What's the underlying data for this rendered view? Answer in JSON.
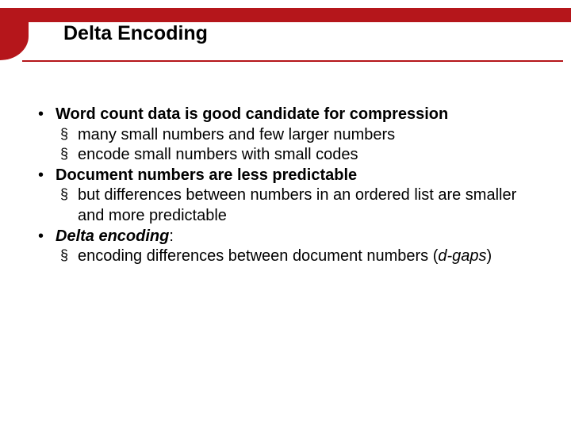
{
  "title": "Delta Encoding",
  "bullets": {
    "b1": {
      "text": "Word count data is good candidate for compression",
      "s1": "many small numbers and few larger numbers",
      "s2": "encode small numbers with small codes"
    },
    "b2": {
      "text": "Document numbers are less predictable",
      "s1": "but differences between numbers in an ordered list are smaller and more predictable"
    },
    "b3": {
      "label": "Delta encoding",
      "colon": ":",
      "s1_pre": "encoding differences between document numbers (",
      "s1_em": "d-gaps",
      "s1_post": ")"
    }
  }
}
